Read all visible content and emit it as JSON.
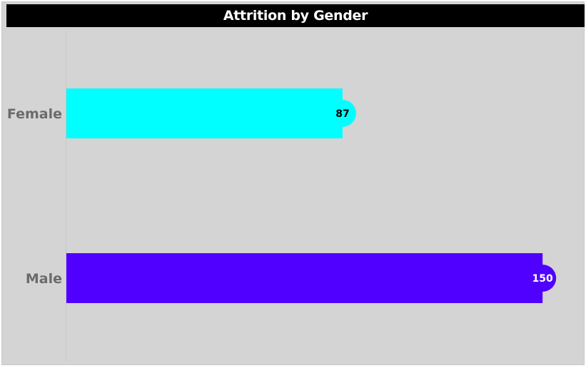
{
  "chart_data": {
    "type": "bar",
    "orientation": "horizontal",
    "title": "Attrition by Gender",
    "categories": [
      "Female",
      "Male"
    ],
    "values": [
      87,
      150
    ],
    "colors": [
      "#00ffff",
      "#5000ff"
    ],
    "value_label_colors": [
      "#000000",
      "#ffffff"
    ],
    "xlim": [
      0,
      163
    ],
    "grid": false,
    "legend": "none"
  },
  "colors": {
    "panel_background": "#d4d4d4",
    "title_background": "#000000",
    "title_text": "#ffffff",
    "category_text": "#6b6b6b"
  }
}
